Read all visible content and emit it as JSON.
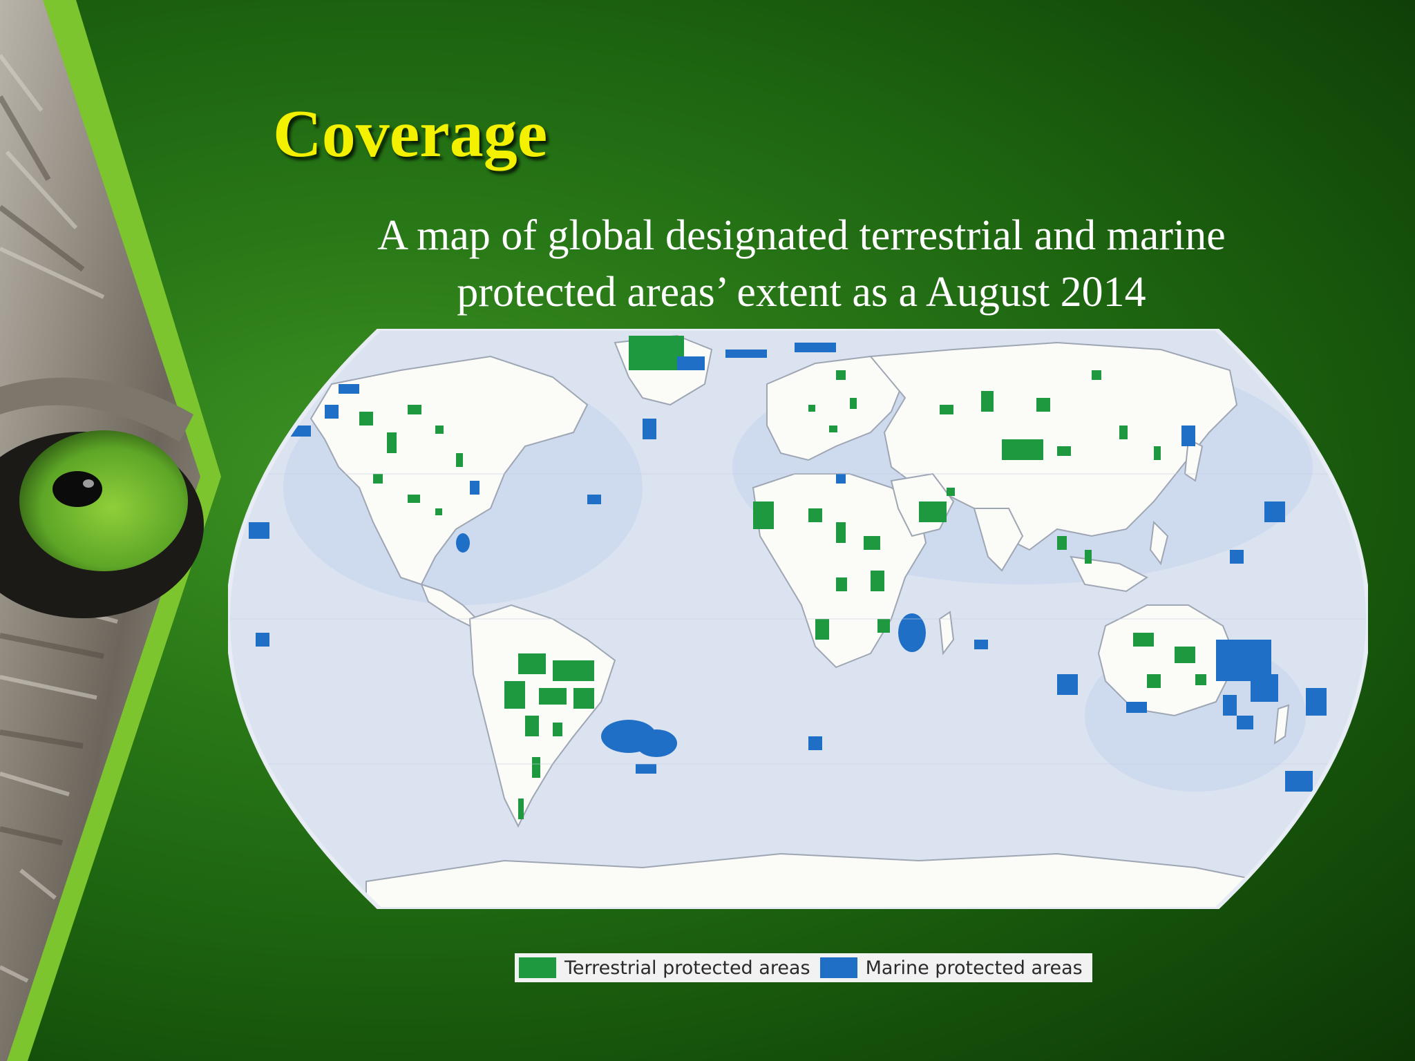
{
  "slide": {
    "title": "Coverage",
    "subtitle_lines": [
      "A map of global designated terrestrial and marine",
      "protected areas’ extent as a August 2014"
    ]
  },
  "map": {
    "projection": "Robinson (world, oval outline)",
    "ocean_color": "#dbe3f1",
    "land_color": "#fbfbf7",
    "terrestrial_color": "#1f9940",
    "marine_color": "#1f6fc6",
    "legend": [
      {
        "label": "Terrestrial protected areas",
        "color": "#1f9940"
      },
      {
        "label": "Marine protected areas",
        "color": "#1f6fc6"
      }
    ]
  },
  "decoration": {
    "left_image": "cat-eye-photo",
    "accent_color": "#7dc52e"
  }
}
